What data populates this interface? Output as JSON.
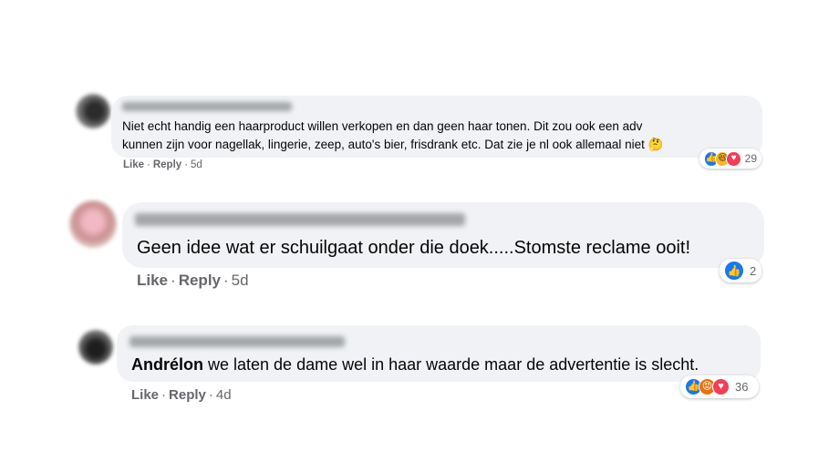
{
  "comments": [
    {
      "text": "Niet echt handig een haarproduct willen verkopen en dan geen haar tonen. Dit zou ook een adv",
      "text2": "kunnen zijn voor nagellak, lingerie, zeep, auto's bier, frisdrank etc. Dat zie je nl ook allemaal niet",
      "emoji": "🤔",
      "like": "Like",
      "reply": "Reply",
      "time": "5d",
      "reaction_count": "29",
      "reactions": [
        "like-icon",
        "haha-icon",
        "love-icon"
      ]
    },
    {
      "text": "Geen idee wat er schuilgaat onder die doek.....Stomste reclame ooit!",
      "like": "Like",
      "reply": "Reply",
      "time": "5d",
      "reaction_count": "2",
      "reactions": [
        "like-icon"
      ]
    },
    {
      "tag": "Andrélon",
      "text": " we laten de dame wel in haar waarde maar de advertentie is slecht.",
      "like": "Like",
      "reply": "Reply",
      "time": "4d",
      "reaction_count": "36",
      "reactions": [
        "like-icon",
        "angry-icon",
        "love-icon"
      ]
    }
  ],
  "colors": {
    "bubble": "#f0f2f5",
    "meta_text": "#65676b",
    "like": "#1877f2",
    "love": "#f33e58",
    "haha": "#f7b928",
    "angry": "#e9710f"
  }
}
